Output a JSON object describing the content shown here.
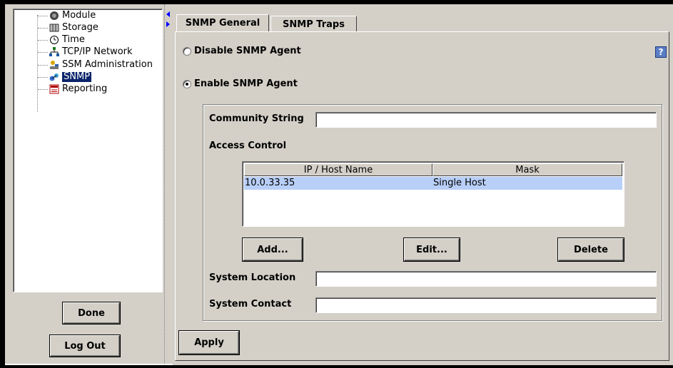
{
  "tree": {
    "items": [
      {
        "label": "Module",
        "icon": "module-icon"
      },
      {
        "label": "Storage",
        "icon": "storage-icon"
      },
      {
        "label": "Time",
        "icon": "clock-icon"
      },
      {
        "label": "TCP/IP Network",
        "icon": "network-icon"
      },
      {
        "label": "SSM Administration",
        "icon": "admin-icon"
      },
      {
        "label": "SNMP",
        "icon": "snmp-icon",
        "selected": true
      },
      {
        "label": "Reporting",
        "icon": "reporting-icon"
      }
    ]
  },
  "left_buttons": {
    "done": "Done",
    "logout": "Log Out"
  },
  "tabs": [
    {
      "label": "SNMP General",
      "active": true
    },
    {
      "label": "SNMP Traps",
      "active": false
    }
  ],
  "agent": {
    "disable_label": "Disable SNMP Agent",
    "enable_label": "Enable SNMP Agent",
    "selected": "enable"
  },
  "form": {
    "community_label": "Community String",
    "community_value": "",
    "access_control_label": "Access Control",
    "location_label": "System Location",
    "location_value": "",
    "contact_label": "System Contact",
    "contact_value": ""
  },
  "access_table": {
    "columns": [
      "IP / Host Name",
      "Mask"
    ],
    "rows": [
      [
        "10.0.33.35",
        "Single Host"
      ]
    ]
  },
  "table_buttons": {
    "add": "Add...",
    "edit": "Edit...",
    "delete": "Delete"
  },
  "apply_label": "Apply",
  "help_label": "?",
  "colors": {
    "selection": "#0a246a",
    "row_highlight": "#b8cff8",
    "panel": "#d4d0c8"
  }
}
